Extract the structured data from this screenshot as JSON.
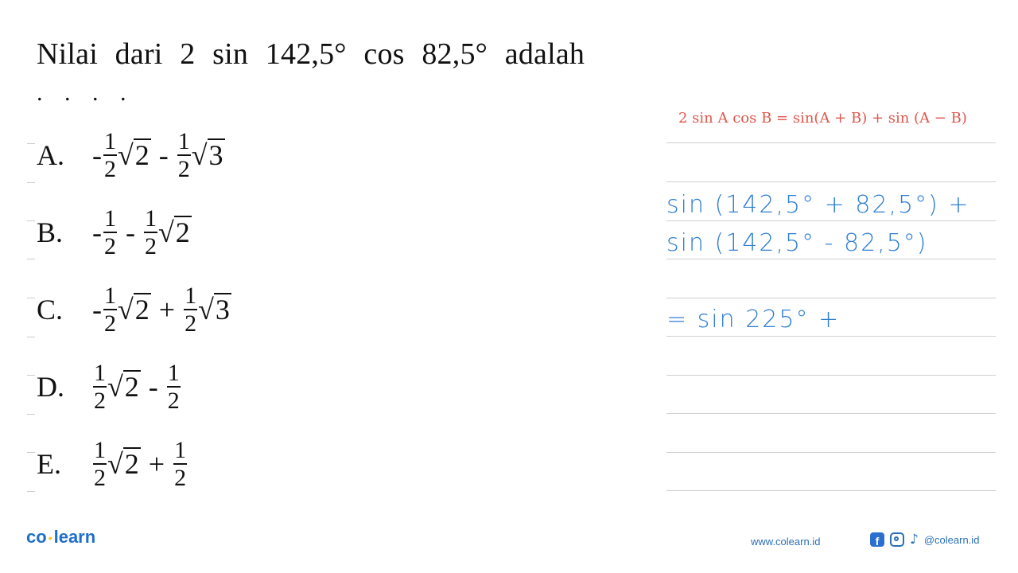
{
  "question": {
    "text": "Nilai dari 2 sin 142,5° cos 82,5° adalah",
    "ellipsis": ". . . ."
  },
  "options": [
    {
      "letter": "A.",
      "terms": [
        {
          "sign": "-",
          "num": "1",
          "den": "2",
          "root": "2"
        },
        {
          "op": "-",
          "num": "1",
          "den": "2",
          "root": "3"
        }
      ]
    },
    {
      "letter": "B.",
      "terms": [
        {
          "sign": "-",
          "num": "1",
          "den": "2",
          "root": ""
        },
        {
          "op": "-",
          "num": "1",
          "den": "2",
          "root": "2"
        }
      ]
    },
    {
      "letter": "C.",
      "terms": [
        {
          "sign": "-",
          "num": "1",
          "den": "2",
          "root": "2"
        },
        {
          "op": "+",
          "num": "1",
          "den": "2",
          "root": "3"
        }
      ]
    },
    {
      "letter": "D.",
      "terms": [
        {
          "sign": "",
          "num": "1",
          "den": "2",
          "root": "2"
        },
        {
          "op": "-",
          "num": "1",
          "den": "2",
          "root": ""
        }
      ]
    },
    {
      "letter": "E.",
      "terms": [
        {
          "sign": "",
          "num": "1",
          "den": "2",
          "root": "2"
        },
        {
          "op": "+",
          "num": "1",
          "den": "2",
          "root": ""
        }
      ]
    }
  ],
  "solution": {
    "formula": "2 sin A cos B = sin(A + B) + sin (A − B)",
    "formula_color": "#e0564b",
    "handwritten_lines": [
      "sin (142,5° + 82,5°) +",
      "sin (142,5° - 82,5°)",
      "= sin 225° +"
    ],
    "ink_color": "#2f7fd3"
  },
  "footer": {
    "logo_left": "co",
    "logo_right": "learn",
    "website": "www.colearn.id",
    "social_icons": [
      "facebook-icon",
      "instagram-icon",
      "tiktok-icon"
    ],
    "handle": "@colearn.id",
    "brand_color": "#1f6fc9"
  }
}
